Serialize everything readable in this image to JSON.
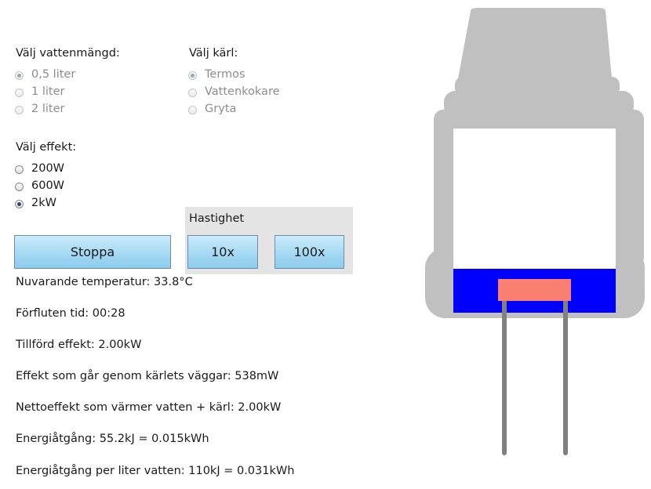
{
  "water": {
    "title": "Välj vattenmängd:",
    "options": [
      {
        "label": "0,5 liter",
        "checked": true
      },
      {
        "label": "1 liter",
        "checked": false
      },
      {
        "label": "2 liter",
        "checked": false
      }
    ]
  },
  "vessel": {
    "title": "Välj kärl:",
    "options": [
      {
        "label": "Termos",
        "checked": true
      },
      {
        "label": "Vattenkokare",
        "checked": false
      },
      {
        "label": "Gryta",
        "checked": false
      }
    ]
  },
  "power": {
    "title": "Välj effekt:",
    "options": [
      {
        "label": "200W",
        "checked": false
      },
      {
        "label": "600W",
        "checked": false
      },
      {
        "label": "2kW",
        "checked": true
      }
    ]
  },
  "controls": {
    "stop_label": "Stoppa",
    "speed_title": "Hastighet",
    "speed_10x": "10x",
    "speed_100x": "100x"
  },
  "stats": {
    "temperature": "Nuvarande temperatur: 33.8°C",
    "elapsed": "Förfluten tid: 00:28",
    "supplied": "Tillförd effekt: 2.00kW",
    "wall_loss": "Effekt som går genom kärlets väggar: 538mW",
    "net": "Nettoeffekt som värmer vatten + kärl: 2.00kW",
    "energy": "Energiåtgång: 55.2kJ = 0.015kWh",
    "energy_per_liter": "Energiåtgång per liter vatten: 110kJ = 0.031kWh"
  },
  "visual": {
    "thermos_color": "#c0c0c0",
    "interior_color": "#ffffff",
    "water_color": "#0000ff",
    "heater_color": "#fa8072",
    "rod_color": "#808080",
    "water_level": 0.24
  }
}
